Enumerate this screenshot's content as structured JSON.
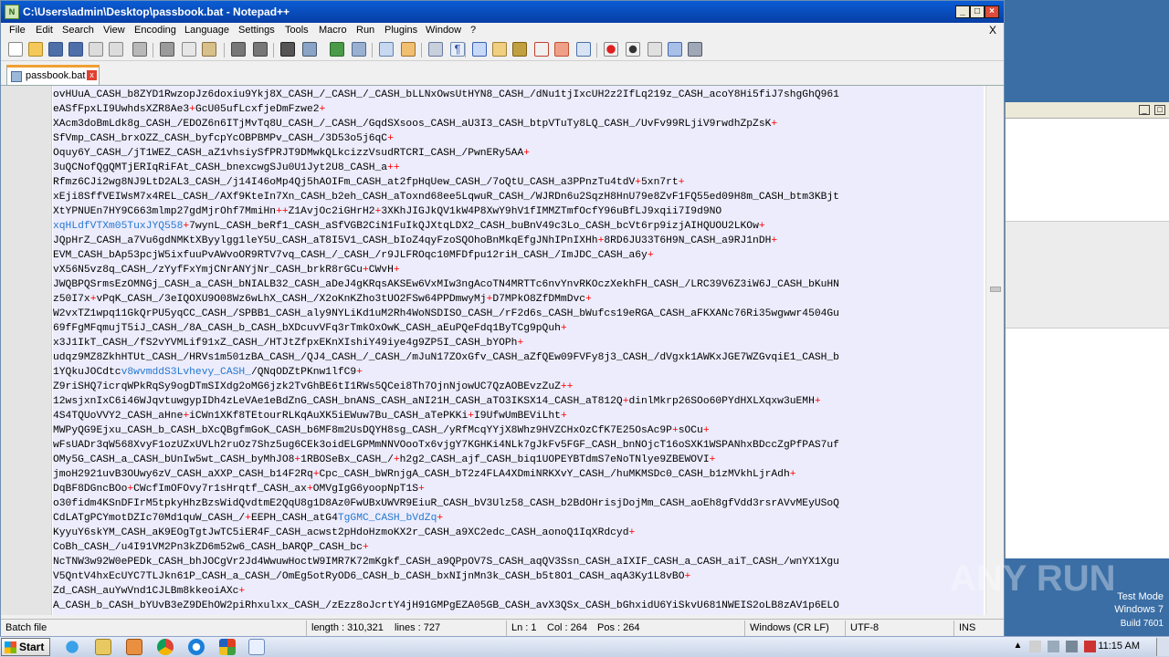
{
  "window": {
    "title": "C:\\Users\\admin\\Desktop\\passbook.bat - Notepad++",
    "app_icon": "notepad-plus-plus-icon",
    "controls": [
      "minimize-icon",
      "maximize-icon",
      "close-icon"
    ]
  },
  "menu": {
    "items": [
      "File",
      "Edit",
      "Search",
      "View",
      "Encoding",
      "Language",
      "Settings",
      "Tools",
      "Macro",
      "Run",
      "Plugins",
      "Window",
      "?"
    ],
    "close_label": "X"
  },
  "toolbar": {
    "icons": [
      "new-file-icon",
      "open-file-icon",
      "save-icon",
      "save-all-icon",
      "close-icon",
      "close-all-icon",
      "print-icon",
      "cut-icon",
      "copy-icon",
      "paste-icon",
      "undo-icon",
      "redo-icon",
      "find-icon",
      "replace-icon",
      "zoom-in-icon",
      "zoom-out-icon",
      "sync-vertical-icon",
      "sync-horizontal-icon",
      "word-wrap-icon",
      "show-all-chars-icon",
      "indent-guide-icon",
      "doc-map-icon",
      "function-list-icon",
      "folder-workspace-icon",
      "monitor-icon",
      "macro-record-icon",
      "macro-stop-icon",
      "macro-play-icon",
      "macro-play-multiple-icon",
      "macro-save-icon"
    ]
  },
  "tabs": [
    {
      "label": "passbook.bat",
      "active": true
    }
  ],
  "editor": {
    "language": "Batch file",
    "lines": [
      [
        [
          "ovHUuA_CASH_b8ZYD1RwzopJz6doxiu9Ykj8X_CASH_/_CASH_/_CASH_bLLNxOwsUtHYN8_CASH_/dNu1tjIxcUH2z2IfLq219z_CASH_acoY8Hi5fiJ7shgGhQ961",
          ""
        ]
      ],
      [
        [
          "eASfFpxLI9UwhdsXZR8Ae3",
          ""
        ],
        [
          "+",
          "op"
        ],
        [
          "GcU05ufLcxfjeDmFzwe2",
          ""
        ],
        [
          "+",
          "op"
        ]
      ],
      [
        [
          "XAcm3doBmLdk8g_CASH_/EDOZ6n6ITjMvTq8U_CASH_/_CASH_/GqdSXsoos_CASH_aU3I3_CASH_btpVTuTy8LQ_CASH_/UvFv99RLjiV9rwdhZpZsK",
          ""
        ],
        [
          "+",
          "op"
        ]
      ],
      [
        [
          "SfVmp_CASH_brxOZZ_CASH_byfcpYcOBPBMPv_CASH_/3D53o5j6qC",
          ""
        ],
        [
          "+",
          "op"
        ]
      ],
      [
        [
          "Oquy6Y_CASH_/jT1WEZ_CASH_aZ1vhsiySfPRJT9DMwkQLkcizzVsudRTCRI_CASH_/PwnERy5AA",
          ""
        ],
        [
          "+",
          "op"
        ]
      ],
      [
        [
          "3uQCNofQgQMTjERIqRiFAt_CASH_bnexcwgSJu0U1Jyt2U8_CASH_a",
          ""
        ],
        [
          "++",
          "op"
        ]
      ],
      [
        [
          "Rfmz6CJi2wg8NJ9LtD2AL3_CASH_/j14I46oMp4Qj5hAOIFm_CASH_at2fpHqUew_CASH_/7oQtU_CASH_a3PPnzTu4tdV",
          ""
        ],
        [
          "+",
          "op"
        ],
        [
          "5xn7rt",
          ""
        ],
        [
          "+",
          "op"
        ]
      ],
      [
        [
          "xEji8SffVEIWsM7x4REL_CASH_/AXf9KteIn7Xn_CASH_b2eh_CASH_aToxnd68ee5LqwuR_CASH_/WJRDn6u2SqzH8HnU79e8ZvF1FQ55ed09H8m_CASH_btm3KBjt",
          ""
        ]
      ],
      [
        [
          "XtYPNUEn7HY9C663mlmp27gdMjrOhf7MmiHn",
          ""
        ],
        [
          "++",
          "op"
        ],
        [
          "Z1AvjOc2iGHrH2",
          ""
        ],
        [
          "+",
          "op"
        ],
        [
          "3XKhJIGJkQV1kW4P8XwY9hV1fIMMZTmfOcfY96uBfLJ9xqii7I9d9NO",
          ""
        ]
      ],
      [
        [
          "xqHLdfVTXm05TuxJYQ558",
          "blue"
        ],
        [
          "+",
          "op"
        ],
        [
          "7wynL_CASH_beRf1_CASH_aSfVGB2CiN1FuIkQJXtqLDX2_CASH_buBnV49c3Lo_CASH_bcVt6rp9izjAIHQUOU2LKOw",
          ""
        ],
        [
          "+",
          "op"
        ]
      ],
      [
        [
          "JQpHrZ_CASH_a7Vu6gdNMKtXByylgg1leY5U_CASH_aT8I5V1_CASH_bIoZ4qyFzoSQOhoBnMkqEfgJNhIPnIXHh",
          ""
        ],
        [
          "+",
          "op"
        ],
        [
          "8RD6JU33T6H9N_CASH_a9RJ1nDH",
          ""
        ],
        [
          "+",
          "op"
        ]
      ],
      [
        [
          "EVM_CASH_bAp53pcjW5ixfuuPvAWvoOR9RTV7vq_CASH_/_CASH_/r9JLFROqc10MFDfpu12riH_CASH_/ImJDC_CASH_a6y",
          ""
        ],
        [
          "+",
          "op"
        ]
      ],
      [
        [
          "vX56N5vz8q_CASH_/zYyfFxYmjCNrANYjNr_CASH_brkR8rGCu",
          ""
        ],
        [
          "+",
          "op"
        ],
        [
          "CWvH",
          ""
        ],
        [
          "+",
          "op"
        ]
      ],
      [
        [
          "JWQBPQSrmsEzOMNGj_CASH_a_CASH_bNIALB32_CASH_aDeJ4gKRqsAKSEw6VxMIw3ngAcoTN4MRTTc6nvYnvRKOczXekhFH_CASH_/LRC39V6Z3iW6J_CASH_bKuHN",
          ""
        ]
      ],
      [
        [
          "z50I7x",
          ""
        ],
        [
          "+",
          "op"
        ],
        [
          "vPqK_CASH_/3eIQOXU9O08Wz6wLhX_CASH_/X2oKnKZho3tUO2FSw64PPDmwyMj",
          ""
        ],
        [
          "+",
          "op"
        ],
        [
          "D7MPkO8ZfDMmDvc",
          ""
        ],
        [
          "+",
          "op"
        ]
      ],
      [
        [
          "W2vxTZ1wpq11GkQrPU5yqCC_CASH_/SPBB1_CASH_aly9NYLiKd1uM2Rh4WoNSDISO_CASH_/rF2d6s_CASH_bWufcs19eRGA_CASH_aFKXANc76Ri35wgwwr4504Gu",
          ""
        ]
      ],
      [
        [
          "69fFgMFqmujT5iJ_CASH_/8A_CASH_b_CASH_bXDcuvVFq3rTmkOxOwK_CASH_aEuPQeFdq1ByTCg9pQuh",
          ""
        ],
        [
          "+",
          "op"
        ]
      ],
      [
        [
          "x3J1IkT_CASH_/fS2vYVMLif91xZ_CASH_/HTJtZfpxEKnXIshiY49iye4g9ZP5I_CASH_bYOPh",
          ""
        ],
        [
          "+",
          "op"
        ]
      ],
      [
        [
          "udqz9MZ8ZkhHTUt_CASH_/HRVs1m501zBA_CASH_/QJ4_CASH_/_CASH_/mJuN17ZOxGfv_CASH_aZfQEw09FVFy8j3_CASH_/dVgxk1AWKxJGE7WZGvqiE1_CASH_b",
          ""
        ]
      ],
      [
        [
          "1YQkuJOCdtc",
          ""
        ],
        [
          "v8wvmddS3Lvhevy_CASH_",
          "blue"
        ],
        [
          "/QNqODZtPKnw1lfC9",
          ""
        ],
        [
          "+",
          "op"
        ]
      ],
      [
        [
          "Z9riSHQ7icrqWPkRqSy9ogDTmSIXdg2oMG6jzk2TvGhBE6tI1RWs5QCei8Th7OjnNjowUC7QzAOBEvzZuZ",
          ""
        ],
        [
          "++",
          "op"
        ]
      ],
      [
        [
          "12wsjxnIxC6i46WJqvtuwgypIDh4zLeVAe1eBdZnG_CASH_bnANS_CASH_aNI21H_CASH_aTO3IKSX14_CASH_aT812Q",
          ""
        ],
        [
          "+",
          "op"
        ],
        [
          "dinlMkrp26SOo60PYdHXLXqxw3uEMH",
          ""
        ],
        [
          "+",
          "op"
        ]
      ],
      [
        [
          "4S4TQUoVVY2_CASH_aHne",
          ""
        ],
        [
          "+",
          "op"
        ],
        [
          "iCWn1XKf8TEtourRLKqAuXK5iEWuw7Bu_CASH_aTePKKi",
          ""
        ],
        [
          "+",
          "op"
        ],
        [
          "I9UfwUmBEViLht",
          ""
        ],
        [
          "+",
          "op"
        ]
      ],
      [
        [
          "MWPyQG9Ejxu_CASH_b_CASH_bXcQBgfmGoK_CASH_b6MF8m2UsDQYH8sg_CASH_/yRfMcqYYjX8Whz9HVZCHxOzCfK7E25OsAc9P",
          ""
        ],
        [
          "+",
          "op"
        ],
        [
          "sOCu",
          ""
        ],
        [
          "+",
          "op"
        ]
      ],
      [
        [
          "wFsUADr3qW568XvyF1ozUZxUVLh2ruOz7Shz5ug6CEk3oidELGPMmNNVOooTx6vjgY7KGHKi4NLk7gJkFv5FGF_CASH_bnNOjcT16oSXK1WSPANhxBDccZgPfPAS7uf",
          ""
        ]
      ],
      [
        [
          "OMy5G_CASH_a_CASH_bUnIw5wt_CASH_byMhJO8",
          ""
        ],
        [
          "+",
          "op"
        ],
        [
          "1RBOSeBx_CASH_/",
          ""
        ],
        [
          "+",
          "op"
        ],
        [
          "h2g2_CASH_ajf_CASH_biq1UOPEYBTdmS7eNoTNlye9ZBEWOVI",
          ""
        ],
        [
          "+",
          "op"
        ]
      ],
      [
        [
          "jmoH2921uvB3OUwy6zV_CASH_aXXP_CASH_b14F2Rq",
          ""
        ],
        [
          "+",
          "op"
        ],
        [
          "Cpc_CASH_bWRnjgA_CASH_bT2z4FLA4XDmiNRKXvY_CASH_/huMKMSDc0_CASH_b1zMVkhLjrAdh",
          ""
        ],
        [
          "+",
          "op"
        ]
      ],
      [
        [
          "DqBF8DGncBOo",
          ""
        ],
        [
          "+",
          "op"
        ],
        [
          "CWcfImOFOvy7r1sHrqtf_CASH_ax",
          ""
        ],
        [
          "+",
          "op"
        ],
        [
          "OMVgIgG6yoopNpT1S",
          ""
        ],
        [
          "+",
          "op"
        ]
      ],
      [
        [
          "o30fidm4KSnDFIrM5tpkyHhzBzsWidQvdtmE2QqU8g1D8Az0FwUBxUWVR9EiuR_CASH_bV3Ulz58_CASH_b2BdOHrisjDojMm_CASH_aoEh8gfVdd3rsrAVvMEyUSoQ",
          ""
        ]
      ],
      [
        [
          "CdLATgPCYmotDZIc70Md1quW_CASH_/",
          ""
        ],
        [
          "+",
          "op"
        ],
        [
          "EEPH_CASH_atG4",
          ""
        ],
        [
          "TgGMC_CASH_bVdZq",
          "blue"
        ],
        [
          "+",
          "op"
        ]
      ],
      [
        [
          "KyyuY6skYM_CASH_aK9EOgTgtJwTC5iER4F_CASH_acwst2pHdoHzmoKX2r_CASH_a9XC2edc_CASH_aonoQ1IqXRdcyd",
          ""
        ],
        [
          "+",
          "op"
        ]
      ],
      [
        [
          "CoBh_CASH_/u4I91VM2Pn3kZD6m52w6_CASH_bARQP_CASH_bc",
          ""
        ],
        [
          "+",
          "op"
        ]
      ],
      [
        [
          "NcTNW3w92W0ePEDk_CASH_bhJOCgVr2Jd4WwuwHoctW9IMR7K72mKgkf_CASH_a9QPpOV7S_CASH_aqQV3Ssn_CASH_aIXIF_CASH_a_CASH_aiT_CASH_/wnYX1Xgu",
          ""
        ]
      ],
      [
        [
          "V5QntV4hxEcUYC7TLJkn61P_CASH_a_CASH_/OmEg5otRyOD6_CASH_b_CASH_bxNIjnMn3k_CASH_b5t8O1_CASH_aqA3Ky1L8vBO",
          ""
        ],
        [
          "+",
          "op"
        ]
      ],
      [
        [
          "Zd_CASH_auYwVnd1CJLBm8kkeoiAXc",
          ""
        ],
        [
          "+",
          "op"
        ]
      ],
      [
        [
          "A_CASH_b_CASH_bYUvB3eZ9DEhOW2piRhxulxx_CASH_/zEzz8oJcrtY4jH91GMPgEZA05GB_CASH_avX3QSx_CASH_bGhxidU6YiSkvU681NWEIS2oLB8zAV1p6ELO",
          ""
        ]
      ]
    ]
  },
  "status": {
    "type": "Batch file",
    "length": "length : 310,321",
    "lines": "lines : 727",
    "ln": "Ln : 1",
    "col": "Col : 264",
    "pos": "Pos : 264",
    "eol": "Windows (CR LF)",
    "encoding": "UTF-8",
    "mode": "INS"
  },
  "desktop": {
    "test_mode": "Test Mode",
    "os_name": "Windows 7",
    "build": "Build 7601",
    "watermark": "ANY RUN"
  },
  "taskbar": {
    "start_label": "Start",
    "apps": [
      "internet-explorer-icon",
      "file-explorer-icon",
      "media-player-icon",
      "chrome-icon",
      "edge-icon",
      "app-grid-icon",
      "notepad-plus-plus-icon"
    ],
    "tray": [
      "show-hidden-icons-icon",
      "flag-icon",
      "network-icon",
      "volume-icon",
      "security-icon"
    ],
    "clock": "11:15 AM"
  },
  "colors": {
    "operator": "#ff0000",
    "link": "#2478d0",
    "selection": "#ececfc",
    "titlebar": "#0a5dd5"
  }
}
